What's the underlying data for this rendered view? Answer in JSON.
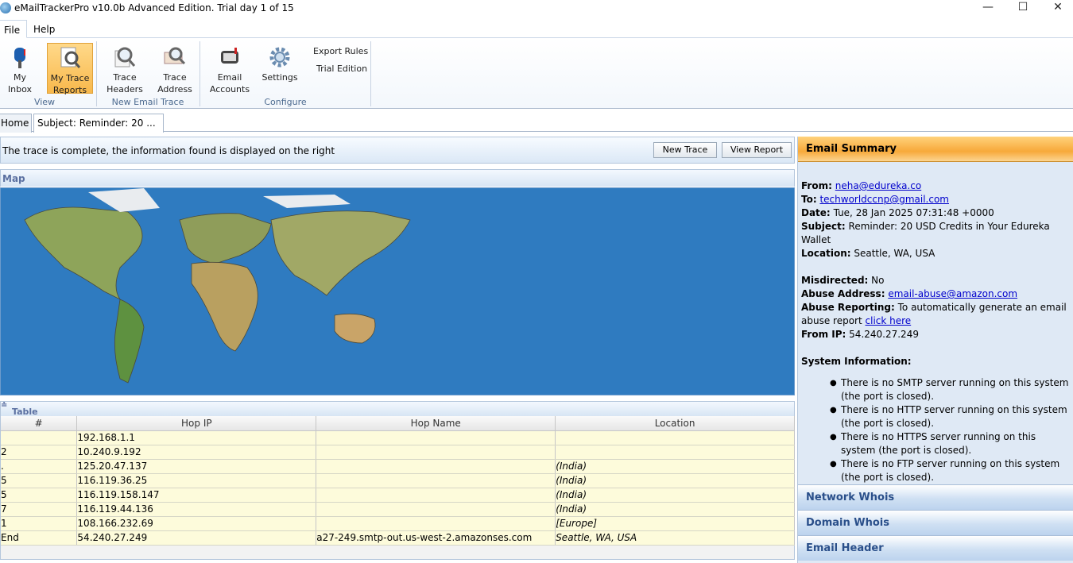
{
  "window": {
    "title": "eMailTrackerPro v10.0b Advanced Edition. Trial day 1 of 15",
    "minimize": "—",
    "maximize": "☐",
    "close": "✕"
  },
  "menu": {
    "file": "File",
    "help": "Help"
  },
  "ribbon": {
    "my_inbox": [
      "My",
      "Inbox"
    ],
    "my_trace_reports": [
      "My Trace",
      "Reports"
    ],
    "trace_headers": [
      "Trace",
      "Headers"
    ],
    "trace_address": [
      "Trace",
      "Address"
    ],
    "email_accounts": [
      "Email",
      "Accounts"
    ],
    "settings": "Settings",
    "export_rules": "Export Rules",
    "trial_edition": "Trial Edition",
    "group_view": "View",
    "group_new_email_trace": "New Email Trace",
    "group_configure": "Configure"
  },
  "tabs": {
    "home": "Home",
    "subject": "Subject: Reminder: 20 ...",
    "close": "✕"
  },
  "status": {
    "message": "The trace is complete, the information found is displayed on the right",
    "new_trace": "New Trace",
    "view_report": "View Report"
  },
  "map": {
    "header": "Map"
  },
  "table": {
    "header": "Table",
    "columns": [
      "#",
      "Hop IP",
      "Hop Name",
      "Location"
    ],
    "rows": [
      {
        "num": "",
        "ip": "192.168.1.1",
        "name": "",
        "loc": ""
      },
      {
        "num": "2",
        "ip": "10.240.9.192",
        "name": "",
        "loc": ""
      },
      {
        "num": ".",
        "ip": "125.20.47.137",
        "name": "",
        "loc": "(India)"
      },
      {
        "num": "5",
        "ip": "116.119.36.25",
        "name": "",
        "loc": "(India)"
      },
      {
        "num": "5",
        "ip": "116.119.158.147",
        "name": "",
        "loc": "(India)"
      },
      {
        "num": "7",
        "ip": "116.119.44.136",
        "name": "",
        "loc": "(India)"
      },
      {
        "num": "1",
        "ip": "108.166.232.69",
        "name": "",
        "loc": "[Europe]"
      },
      {
        "num": "End",
        "ip": "54.240.27.249",
        "name": "a27-249.smtp-out.us-west-2.amazonses.com",
        "loc": "Seattle, WA, USA"
      }
    ]
  },
  "summary": {
    "header": "Email Summary",
    "from_label": "From:",
    "from": "neha@edureka.co",
    "to_label": "To:",
    "to": "techworldccnp@gmail.com",
    "date_label": "Date:",
    "date": "Tue, 28 Jan 2025 07:31:48 +0000",
    "subject_label": "Subject:",
    "subject": "Reminder: 20 USD Credits in Your Edureka Wallet",
    "location_label": "Location:",
    "location": "Seattle, WA, USA",
    "misdirected_label": "Misdirected:",
    "misdirected": "No",
    "abuse_address_label": "Abuse Address:",
    "abuse_address": "email-abuse@amazon.com",
    "abuse_reporting_label": "Abuse Reporting:",
    "abuse_reporting": "To automatically generate an email abuse report",
    "click_here": "click here",
    "from_ip_label": "From IP:",
    "from_ip": "54.240.27.249",
    "system_info_label": "System Information:",
    "system_info": [
      "There is no SMTP server running on this system (the port is closed).",
      "There is no HTTP server running on this system (the port is closed).",
      "There is no HTTPS server running on this system (the port is closed).",
      "There is no FTP server running on this system (the port is closed)."
    ]
  },
  "side_sections": {
    "network_whois": "Network Whois",
    "domain_whois": "Domain Whois",
    "email_header": "Email Header"
  }
}
